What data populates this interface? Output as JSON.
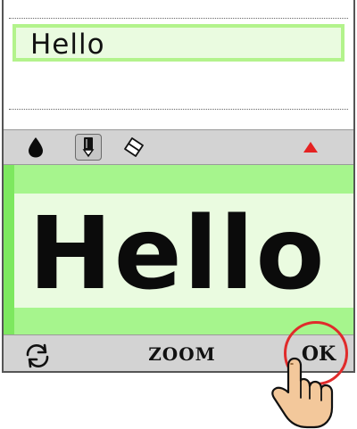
{
  "text_field": {
    "value": "Hello"
  },
  "toolbar": {
    "tools": [
      {
        "icon": "ink-drop-icon"
      },
      {
        "icon": "pen-icon",
        "selected": true
      },
      {
        "icon": "eraser-icon"
      },
      {
        "icon": "collapse-triangle-icon"
      }
    ]
  },
  "canvas": {
    "handwritten_text": "Hello"
  },
  "bottombar": {
    "refresh_icon": "refresh-icon",
    "zoom_label": "ZOOM",
    "ok_label": "OK"
  },
  "colors": {
    "highlight_green": "#b3f38c",
    "canvas_green": "#eafbe0",
    "band_green": "#a6f58d",
    "callout_red": "#e02b2b",
    "collapse_red": "#e52222",
    "toolbar_gray": "#d3d3d3",
    "hand_skin": "#f3c89b"
  }
}
